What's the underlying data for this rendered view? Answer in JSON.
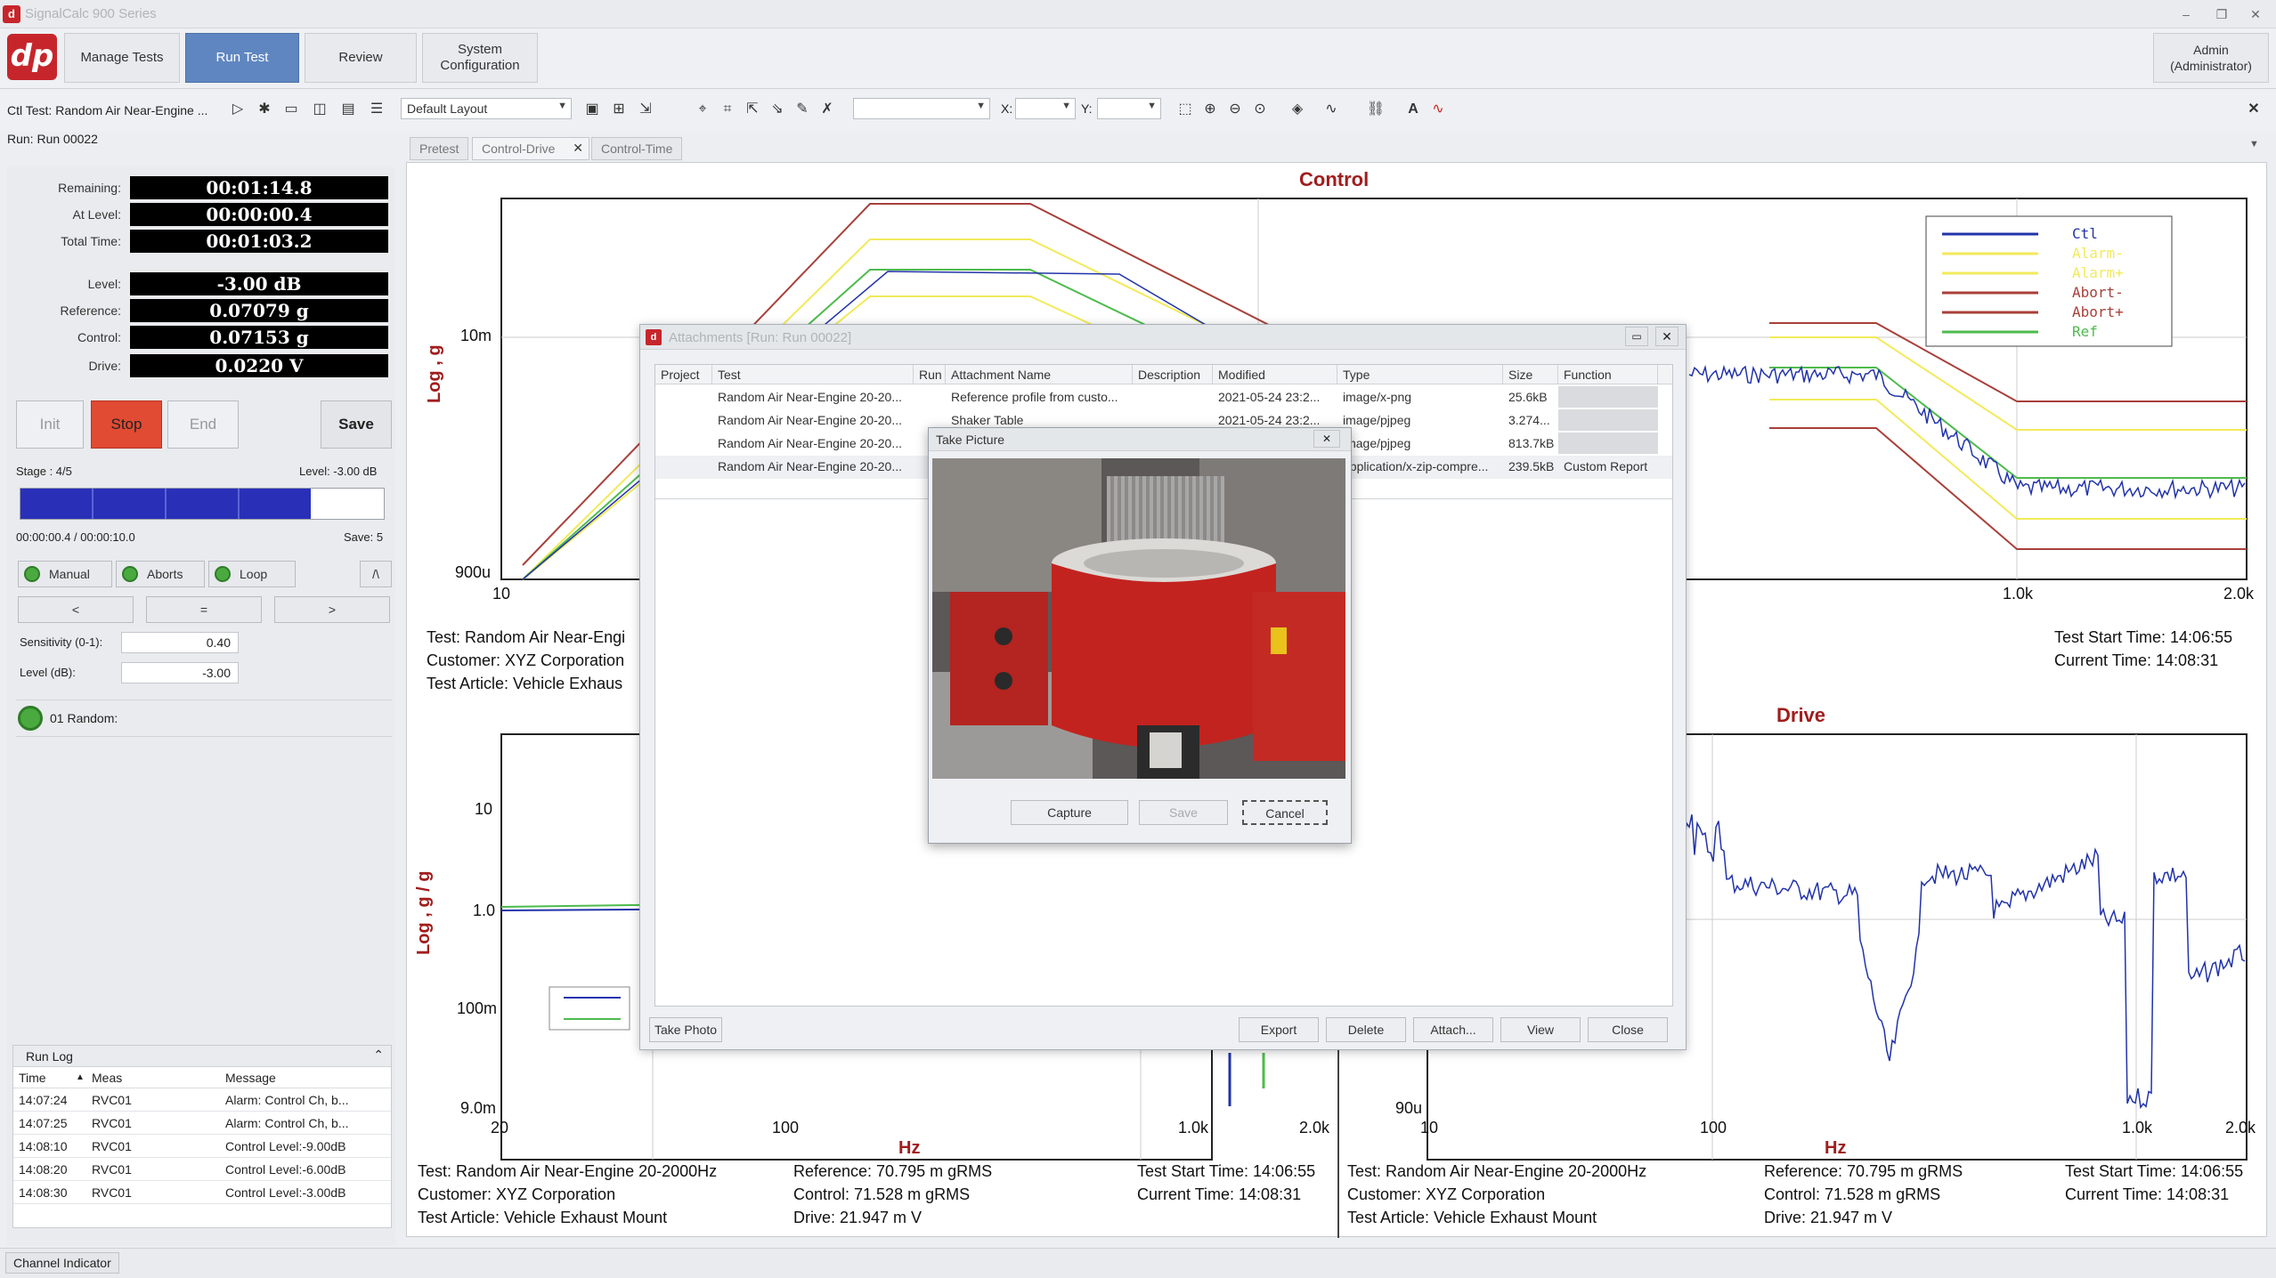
{
  "window": {
    "title": "SignalCalc 900 Series",
    "minimize": "–",
    "restore": "❐",
    "close": "✕"
  },
  "nav": {
    "logo": "dp",
    "items": [
      "Manage Tests",
      "Run Test",
      "Review",
      "System\nConfiguration"
    ],
    "active": "Run Test",
    "user": "Admin\n(Administrator)"
  },
  "toolbar2": {
    "ctl_test": "Ctl Test: Random Air Near-Engine ...",
    "run": "Run: Run 00022",
    "layout": "Default Layout",
    "x_label": "X:",
    "y_label": "Y:",
    "close": "✕"
  },
  "status": [
    {
      "label": "Remaining:",
      "value": "00:01:14.8"
    },
    {
      "label": "At Level:",
      "value": "00:00:00.4"
    },
    {
      "label": "Total Time:",
      "value": "00:01:03.2"
    },
    {
      "label": "Level:",
      "value": "-3.00 dB"
    },
    {
      "label": "Reference:",
      "value": "0.07079 g"
    },
    {
      "label": "Control:",
      "value": "0.07153 g"
    },
    {
      "label": "Drive:",
      "value": "0.0220 V"
    }
  ],
  "controls": {
    "init": "Init",
    "stop": "Stop",
    "end": "End",
    "save": "Save"
  },
  "stage": {
    "label": "Stage : 4/5",
    "level": "Level: -3.00 dB",
    "progress": 0.8,
    "time": "00:00:00.4  /  00:00:10.0",
    "save": "Save: 5"
  },
  "modes": {
    "manual": "Manual",
    "aborts": "Aborts",
    "loop": "Loop",
    "up": "/\\",
    "prev": "<",
    "mid": "=",
    "next": ">"
  },
  "params": {
    "sens_label": "Sensitivity (0-1):",
    "sens": "0.40",
    "level_label": "Level (dB):",
    "level": "-3.00"
  },
  "schedule": {
    "item": "01 Random:"
  },
  "runlog": {
    "title": "Run Log",
    "cols": [
      "Time",
      "Meas",
      "Message"
    ],
    "rows": [
      [
        "14:07:24",
        "RVC01",
        "Alarm: Control Ch, b..."
      ],
      [
        "14:07:25",
        "RVC01",
        "Alarm: Control Ch, b..."
      ],
      [
        "14:08:10",
        "RVC01",
        "Control Level:-9.00dB"
      ],
      [
        "14:08:20",
        "RVC01",
        "Control Level:-6.00dB"
      ],
      [
        "14:08:30",
        "RVC01",
        "Control Level:-3.00dB"
      ]
    ]
  },
  "tabs": [
    "Pretest",
    "Control-Drive",
    "Control-Time"
  ],
  "charts": {
    "control": {
      "title": "Control",
      "ylabel": "Log , g",
      "yticks": [
        "10m",
        "900u"
      ],
      "xticks": [
        "10",
        "1.0k",
        "2.0k"
      ],
      "legend": [
        "Ctl",
        "Alarm-",
        "Alarm+",
        "Abort-",
        "Abort+",
        "Ref"
      ],
      "legend_colors": [
        "#2233aa",
        "#f2ea5a",
        "#f2ea5a",
        "#a8403a",
        "#a8403a",
        "#4dbb4d"
      ],
      "info_left": [
        "Test: Random Air Near-Engi",
        "Customer: XYZ Corporation",
        "Test Article: Vehicle Exhaus"
      ],
      "info_right": [
        "Test Start Time: 14:06:55",
        "Current Time: 14:08:31"
      ]
    },
    "drive_left": {
      "ylabel": "Log , g / g",
      "yticks": [
        "10",
        "1.0",
        "100m",
        "9.0m"
      ],
      "xticks": [
        "20",
        "100",
        "1.0k",
        "2.0k"
      ],
      "xlabel": "Hz",
      "info1": [
        "Test: Random Air Near-Engine 20-2000Hz",
        "Customer: XYZ Corporation",
        "Test Article: Vehicle Exhaust Mount"
      ],
      "info2": [
        "Reference:  70.795 m gRMS",
        "Control:  71.528 m gRMS",
        "Drive:  21.947 m V"
      ],
      "info3": [
        "Test Start Time: 14:06:55",
        "Current Time: 14:08:31"
      ]
    },
    "drive": {
      "title": "Drive",
      "yticks": [
        "90u"
      ],
      "xticks": [
        "10",
        "100",
        "1.0k",
        "2.0k"
      ],
      "xlabel": "Hz",
      "info1": [
        "Test: Random Air Near-Engine 20-2000Hz",
        "Customer: XYZ Corporation",
        "Test Article: Vehicle Exhaust Mount"
      ],
      "info2": [
        "Reference:  70.795 m gRMS",
        "Control:  71.528 m gRMS",
        "Drive:  21.947 m V"
      ],
      "info3": [
        "Test Start Time: 14:06:55",
        "Current Time: 14:08:31"
      ]
    }
  },
  "attachments": {
    "title": "Attachments [Run: Run 00022]",
    "cols": [
      "Project",
      "Test",
      "Run",
      "Attachment Name",
      "Description",
      "Modified",
      "Type",
      "Size",
      "Function"
    ],
    "rows": [
      [
        "",
        "Random Air Near-Engine 20-20...",
        "",
        "Reference profile from custo...",
        "",
        "2021-05-24 23:2...",
        "image/x-png",
        "25.6kB",
        ""
      ],
      [
        "",
        "Random Air Near-Engine 20-20...",
        "",
        "Shaker Table",
        "",
        "2021-05-24 23:2...",
        "image/pjpeg",
        "3.274...",
        ""
      ],
      [
        "",
        "Random Air Near-Engine 20-20...",
        "",
        "",
        "",
        "",
        "image/pjpeg",
        "813.7kB",
        ""
      ],
      [
        "",
        "Random Air Near-Engine 20-20...",
        "",
        "",
        "",
        "",
        "application/x-zip-compre...",
        "239.5kB",
        "Custom Report"
      ]
    ],
    "buttons": {
      "take_photo": "Take Photo",
      "export": "Export",
      "delete": "Delete",
      "attach": "Attach...",
      "view": "View",
      "close": "Close"
    }
  },
  "take_picture": {
    "title": "Take Picture",
    "capture": "Capture",
    "save": "Save",
    "cancel": "Cancel"
  },
  "bottom": {
    "channel_indicator": "Channel Indicator"
  }
}
